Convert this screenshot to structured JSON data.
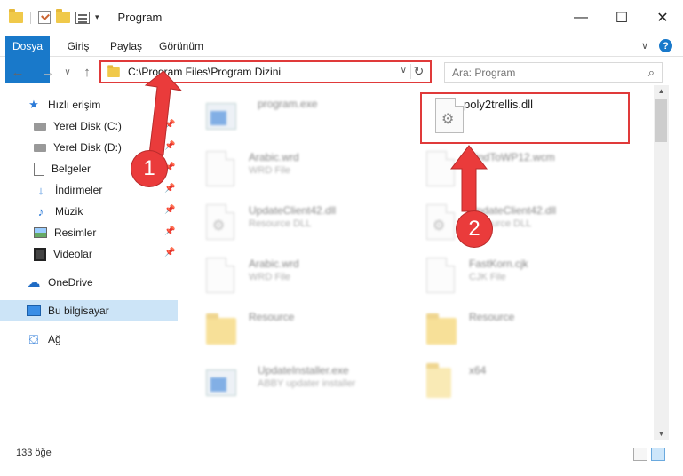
{
  "window": {
    "title": "Program",
    "minimize_icon": "—",
    "maximize_icon": "☐",
    "close_icon": "✕"
  },
  "ribbon": {
    "tabs": [
      "Dosya",
      "Giriş",
      "Paylaş",
      "Görünüm"
    ],
    "help_label": "?",
    "collapse_icon": "∨"
  },
  "nav": {
    "back_icon": "←",
    "forward_icon": "→",
    "recent_icon": "∨",
    "up_icon": "↑",
    "address_path": "C:\\Program Files\\Program Dizini",
    "address_dropdown": "∨",
    "refresh_icon": "↻",
    "search_placeholder": "Ara: Program",
    "search_icon": "⌕"
  },
  "sidebar": {
    "quick_access_label": "Hızlı erişim",
    "pinned": [
      {
        "label": "Yerel Disk (C:)",
        "icon": "drive-icon"
      },
      {
        "label": "Yerel Disk (D:)",
        "icon": "drive-icon"
      },
      {
        "label": "Belgeler",
        "icon": "document-icon"
      },
      {
        "label": "İndirmeler",
        "icon": "download-icon"
      },
      {
        "label": "Müzik",
        "icon": "music-icon"
      },
      {
        "label": "Resimler",
        "icon": "pictures-icon"
      },
      {
        "label": "Videolar",
        "icon": "video-icon"
      }
    ],
    "onedrive_label": "OneDrive",
    "thispc_label": "Bu bilgisayar",
    "network_label": "Ağ",
    "pin_icon": "📌"
  },
  "files": [
    {
      "name": "program.exe",
      "type": "",
      "kind": "exe",
      "blurred": true
    },
    {
      "name": "poly2trellis.dll",
      "type": "",
      "kind": "dll",
      "blurred": false
    },
    {
      "name": "Arabic.wrd",
      "type": "WRD File",
      "kind": "doc",
      "blurred": true
    },
    {
      "name": "FindToWP12.wcm",
      "type": "",
      "kind": "doc",
      "blurred": true
    },
    {
      "name": "UpdateClient42.dll",
      "type": "Resource DLL",
      "kind": "dll",
      "blurred": true
    },
    {
      "name": "UpdateClient42.dll",
      "type": "Resource DLL",
      "kind": "dll",
      "blurred": true
    },
    {
      "name": "Arabic.wrd",
      "type": "WRD File",
      "kind": "doc",
      "blurred": true
    },
    {
      "name": "FastKorn.cjk",
      "type": "CJK File",
      "kind": "doc",
      "blurred": true
    },
    {
      "name": "Resource",
      "type": "",
      "kind": "folder",
      "blurred": true
    },
    {
      "name": "Resource",
      "type": "",
      "kind": "folder",
      "blurred": true
    },
    {
      "name": "UpdateInstaller.exe",
      "type": "ABBY updater installer",
      "kind": "exe",
      "blurred": true
    },
    {
      "name": "x64",
      "type": "",
      "kind": "folder",
      "blurred": true
    }
  ],
  "callouts": [
    "1",
    "2"
  ],
  "status": {
    "item_count": "133 öğe"
  },
  "colors": {
    "accent": "#1979ca",
    "highlight": "#e03a3a",
    "selection": "#cce4f7"
  }
}
